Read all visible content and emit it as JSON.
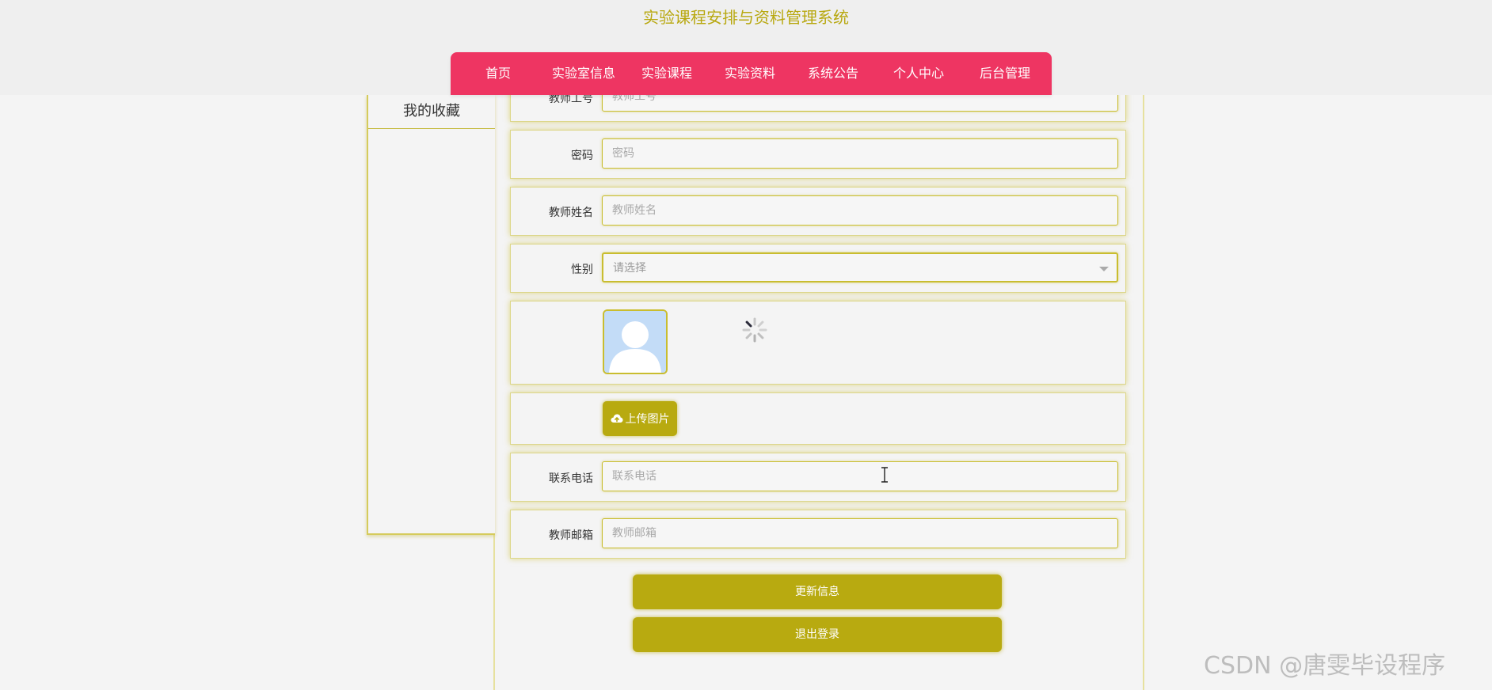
{
  "header": {
    "site_title": "实验课程安排与资料管理系统",
    "nav_items": [
      {
        "label": "首页"
      },
      {
        "label": "实验室信息"
      },
      {
        "label": "实验课程"
      },
      {
        "label": "实验资料"
      },
      {
        "label": "系统公告"
      },
      {
        "label": "个人中心"
      },
      {
        "label": "后台管理"
      }
    ]
  },
  "sidebar": {
    "items": [
      {
        "label": "我的收藏"
      }
    ]
  },
  "form": {
    "teacher_id": {
      "label": "教师工号",
      "placeholder": "教师工号"
    },
    "password": {
      "label": "密码",
      "placeholder": "密码"
    },
    "teacher_name": {
      "label": "教师姓名",
      "placeholder": "教师姓名"
    },
    "gender": {
      "label": "性别",
      "value": "请选择"
    },
    "avatar": {
      "icon": "user-silhouette-icon",
      "loading_icon": "spinner-icon"
    },
    "upload": {
      "label": "上传图片",
      "icon": "cloud-upload-icon"
    },
    "phone": {
      "label": "联系电话",
      "placeholder": "联系电话"
    },
    "email": {
      "label": "教师邮箱",
      "placeholder": "教师邮箱"
    }
  },
  "actions": {
    "update_label": "更新信息",
    "logout_label": "退出登录"
  },
  "watermark": "CSDN @唐雯毕设程序",
  "colors": {
    "accent": "#b8aa10",
    "nav_bg": "#ee3562",
    "title": "#b8a810",
    "avatar_bg": "#c3dcf7"
  }
}
